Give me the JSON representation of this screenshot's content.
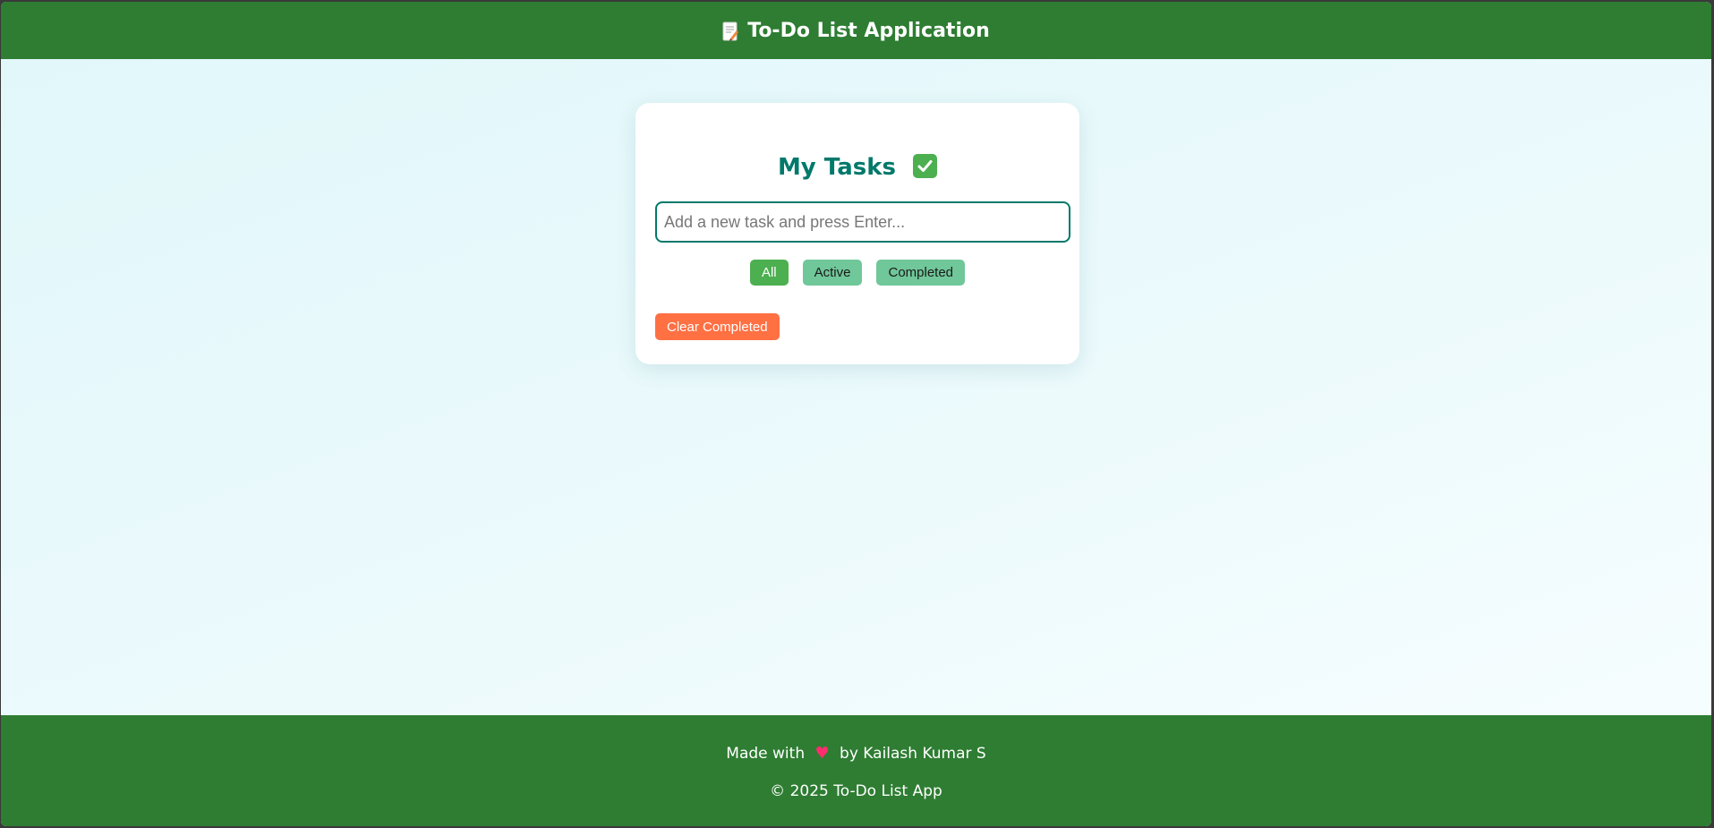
{
  "header": {
    "title": "To-Do List Application",
    "icon": "memo-icon"
  },
  "card": {
    "title": "My Tasks",
    "title_icon": "check-mark-button-icon",
    "input": {
      "placeholder": "Add a new task and press Enter...",
      "value": ""
    },
    "filters": [
      {
        "label": "All",
        "active": true
      },
      {
        "label": "Active",
        "active": false
      },
      {
        "label": "Completed",
        "active": false
      }
    ],
    "clear_label": "Clear Completed"
  },
  "footer": {
    "made_prefix": "Made with",
    "heart": "♥",
    "made_suffix": "by Kailash Kumar S",
    "copyright": "© 2025 To-Do List App"
  },
  "colors": {
    "header_bg": "#2e7d32",
    "accent": "#00796b",
    "filter_active": "#4caf50",
    "filter_inactive": "#70c799",
    "clear_button": "#ff7043",
    "heart": "#ff2d6f"
  }
}
